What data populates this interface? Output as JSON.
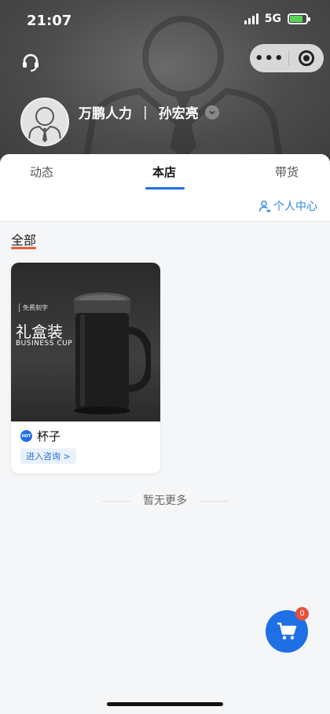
{
  "status_bar": {
    "time": "21:07",
    "network": "5G"
  },
  "profile": {
    "company": "万鹏人力",
    "separator": "|",
    "name": "孙宏亮"
  },
  "tabs": [
    {
      "label": "动态",
      "active": false
    },
    {
      "label": "本店",
      "active": true
    },
    {
      "label": "带货",
      "active": false
    }
  ],
  "personal_center_label": "个人中心",
  "section_title": "全部",
  "products": [
    {
      "name": "杯子",
      "badge": "HOT",
      "consult_label": "进入咨询 >",
      "image_texts": {
        "tag": "免费刻字",
        "title": "礼盒装",
        "subtitle": "BUSINESS CUP"
      }
    }
  ],
  "no_more_text": "暂无更多",
  "cart_badge_count": "0",
  "colors": {
    "accent": "#1f6fe5",
    "tab_underline": "#1f6fe5",
    "section_underline": "#e8603c",
    "badge": "#e8513c"
  },
  "icons": [
    "customer-service-icon",
    "more-dots-icon",
    "mini-program-close-icon",
    "chevron-down-icon",
    "person-icon",
    "cart-icon"
  ]
}
